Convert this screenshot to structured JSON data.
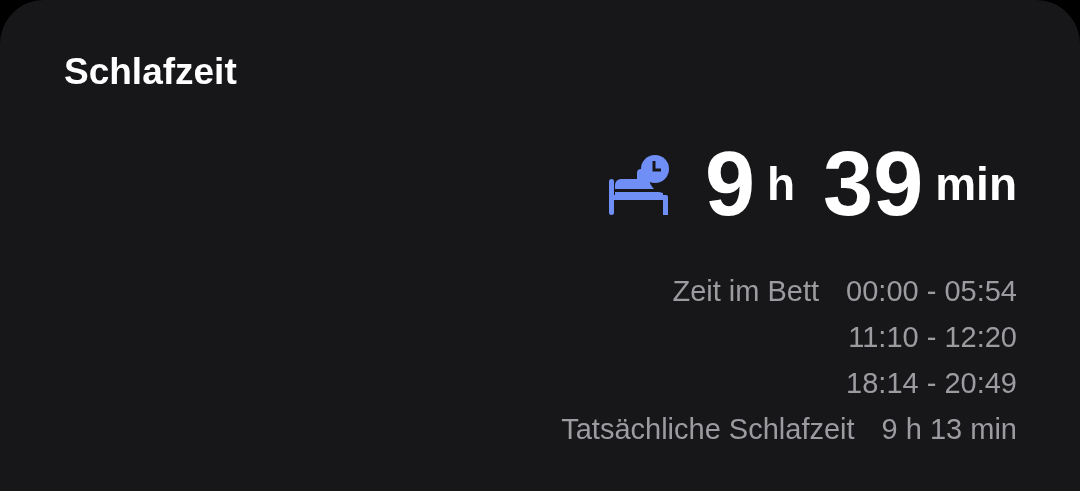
{
  "card": {
    "title": "Schlafzeit",
    "total": [
      {
        "value": "9",
        "unit": "h"
      },
      {
        "value": "39",
        "unit": "min"
      }
    ],
    "details": [
      {
        "label": "Zeit im Bett",
        "values": [
          "00:00 - 05:54",
          "11:10 - 12:20",
          "18:14 - 20:49"
        ]
      },
      {
        "label": "Tatsächliche Schlafzeit",
        "values": [
          "9 h 13 min"
        ]
      }
    ]
  }
}
